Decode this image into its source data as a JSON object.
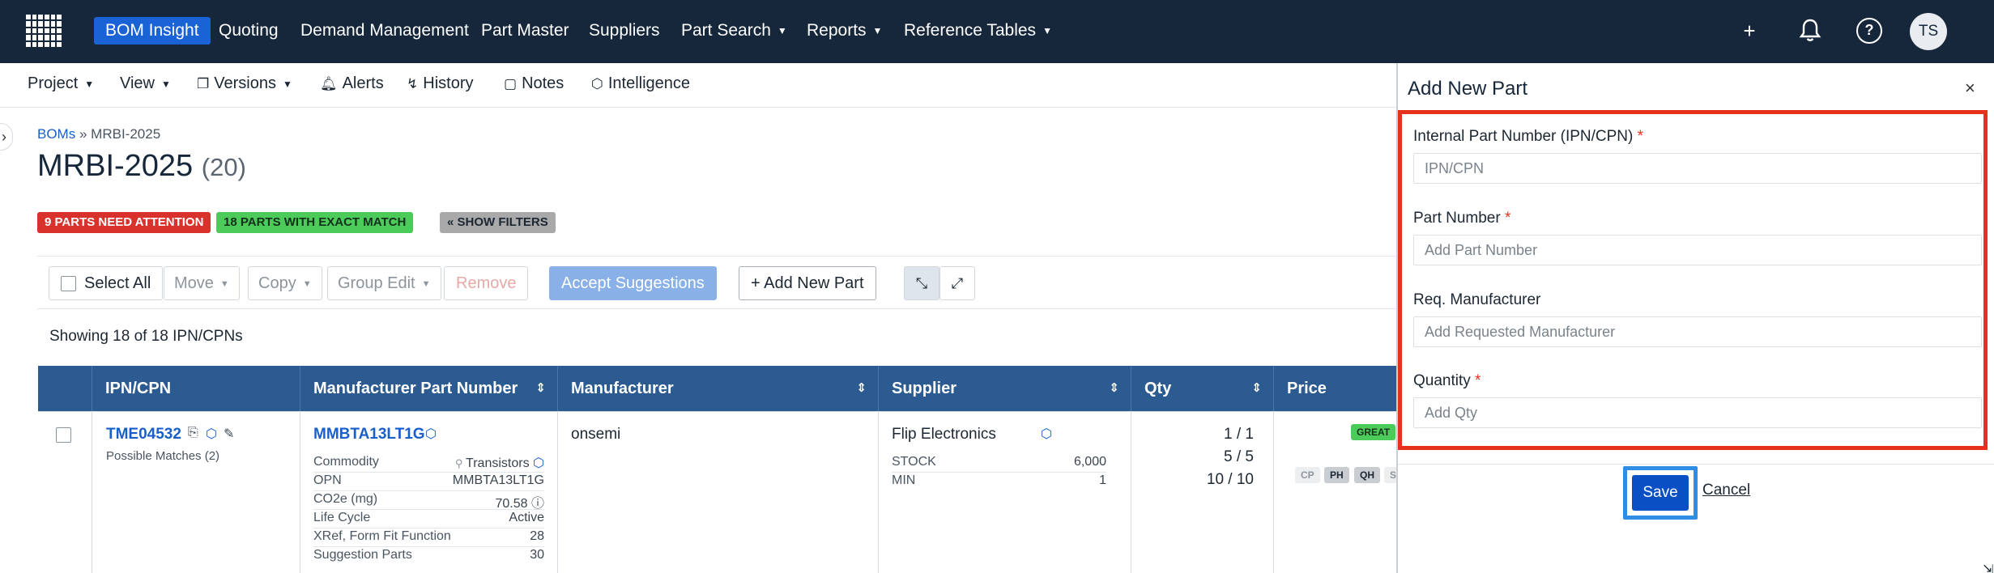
{
  "topnav": {
    "items": [
      {
        "label": "BOM Insight",
        "active": true
      },
      {
        "label": "Quoting"
      },
      {
        "label": "Demand Management"
      },
      {
        "label": "Part Master"
      },
      {
        "label": "Suppliers"
      },
      {
        "label": "Part Search",
        "dropdown": true
      },
      {
        "label": "Reports",
        "dropdown": true
      },
      {
        "label": "Reference Tables",
        "dropdown": true
      }
    ],
    "avatar": "TS",
    "icons": [
      "plus-icon",
      "bell-icon",
      "help-icon"
    ]
  },
  "toolbar": {
    "items": [
      {
        "label": "Project",
        "dropdown": true
      },
      {
        "label": "View",
        "dropdown": true
      },
      {
        "label": "Versions",
        "dropdown": true,
        "icon": "versions-icon"
      },
      {
        "label": "Alerts",
        "icon": "bell-icon"
      },
      {
        "label": "History",
        "icon": "history-icon"
      },
      {
        "label": "Notes",
        "icon": "notes-icon"
      },
      {
        "label": "Intelligence",
        "icon": "cube-icon"
      }
    ]
  },
  "bom": {
    "breadcrumb_root": "BOMs",
    "breadcrumb_sep": "»",
    "breadcrumb_current": "MRBI-2025",
    "title": "MRBI-2025",
    "count": "(20)",
    "badges": {
      "attention": "9 PARTS NEED ATTENTION",
      "exact": "18 PARTS WITH EXACT MATCH",
      "filters": "« SHOW FILTERS"
    },
    "actions": {
      "select_all": "Select All",
      "move": "Move",
      "copy": "Copy",
      "group_edit": "Group Edit",
      "remove": "Remove",
      "accept": "Accept Suggestions",
      "add": "+ Add New Part"
    },
    "showing": "Showing 18 of 18 IPN/CPNs"
  },
  "table": {
    "headers": [
      "IPN/CPN",
      "Manufacturer Part Number",
      "Manufacturer",
      "Supplier",
      "Qty",
      "Price"
    ],
    "row": {
      "ipn": "TME04532",
      "possible_matches": "Possible Matches (2)",
      "mpn": "MMBTA13LT1G",
      "mpn_details": [
        {
          "k": "Commodity",
          "v": "Transistors"
        },
        {
          "k": "OPN",
          "v": "MMBTA13LT1G"
        },
        {
          "k": "CO2e (mg)",
          "v": "70.58"
        },
        {
          "k": "Life Cycle",
          "v": "Active"
        },
        {
          "k": "XRef, Form Fit Function",
          "v": "28"
        },
        {
          "k": "Suggestion Parts",
          "v": "30"
        }
      ],
      "manufacturer": "onsemi",
      "supplier": "Flip Electronics",
      "supplier_details": [
        {
          "k": "STOCK",
          "v": "6,000"
        },
        {
          "k": "MIN",
          "v": "1"
        }
      ],
      "qty": [
        "1 / 1",
        "5 / 5",
        "10 / 10"
      ],
      "price_badge": "GREAT",
      "price_tags": [
        "CP",
        "PH",
        "QH",
        "S"
      ]
    }
  },
  "panel": {
    "title": "Add New Part",
    "close": "×",
    "fields": [
      {
        "label": "Internal Part Number (IPN/CPN)",
        "required": "*",
        "placeholder": "IPN/CPN"
      },
      {
        "label": "Part Number",
        "required": "*",
        "placeholder": "Add Part Number"
      },
      {
        "label": "Req. Manufacturer",
        "required": "",
        "placeholder": "Add Requested Manufacturer"
      },
      {
        "label": "Quantity",
        "required": "*",
        "placeholder": "Add Qty"
      }
    ],
    "save": "Save",
    "cancel": "Cancel"
  },
  "colors": {
    "nav_bg": "#16273b",
    "accent": "#1a63d6",
    "table_header": "#2b5b90",
    "highlight_red": "#e6321c",
    "highlight_blue": "#2f8de4"
  }
}
